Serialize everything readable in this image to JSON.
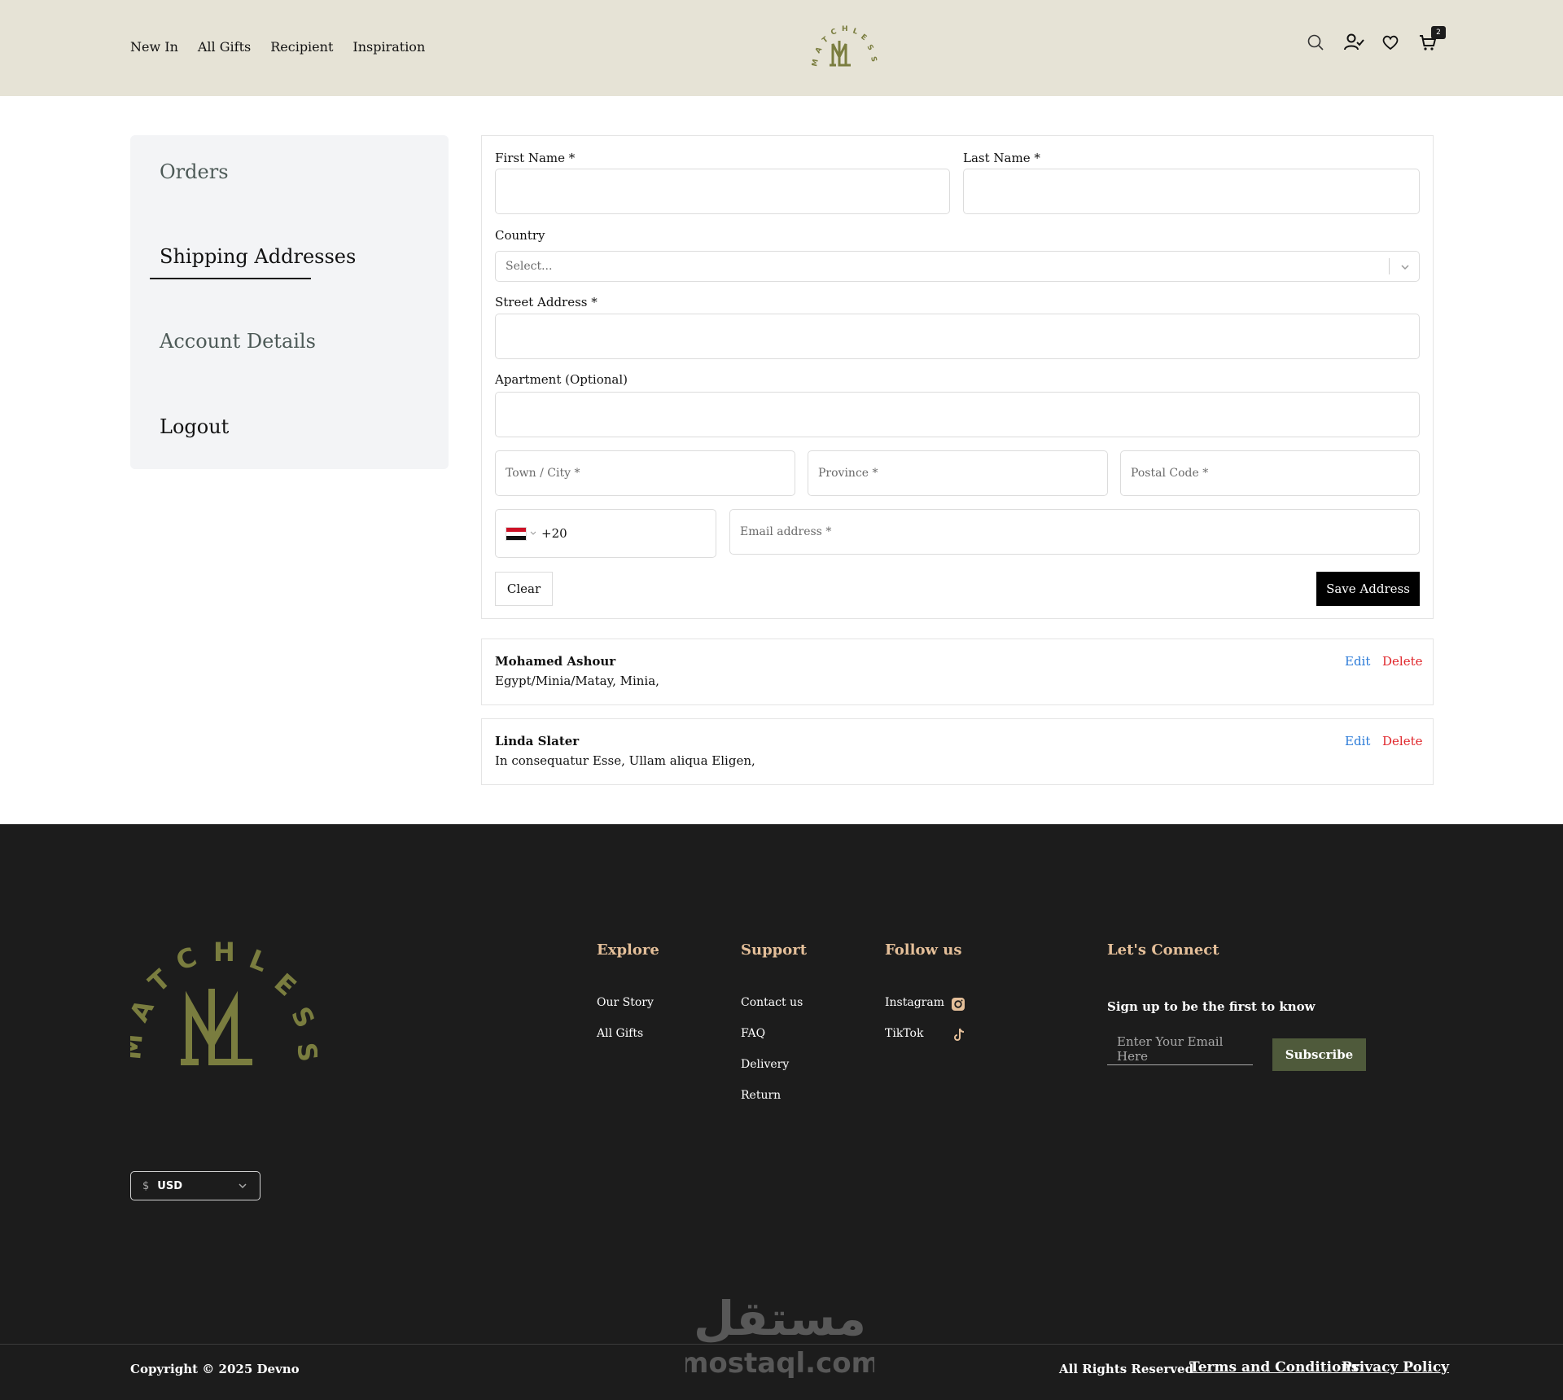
{
  "header": {
    "nav": [
      "New In",
      "All Gifts",
      "Recipient",
      "Inspiration"
    ],
    "cart_count": "2",
    "brand_color": "#7a7d3f"
  },
  "sidebar": {
    "items": [
      "Orders",
      "Shipping Addresses",
      "Account Details",
      "Logout"
    ],
    "active": "Shipping Addresses"
  },
  "form": {
    "first_name_label": "First Name *",
    "last_name_label": "Last Name *",
    "country_label": "Country",
    "country_placeholder": "Select...",
    "street_label": "Street Address *",
    "apartment_label": "Apartment (Optional)",
    "city_placeholder": "Town / City *",
    "province_placeholder": "Province *",
    "postal_placeholder": "Postal Code *",
    "phone_code": "+20",
    "email_placeholder": "Email address *",
    "clear_label": "Clear",
    "save_label": "Save Address"
  },
  "addresses": [
    {
      "name": "Mohamed Ashour",
      "line": "Egypt/Minia/Matay, Minia,",
      "edit": "Edit",
      "delete": "Delete"
    },
    {
      "name": "Linda Slater",
      "line": "In consequatur Esse, Ullam aliqua Eligen,",
      "edit": "Edit",
      "delete": "Delete"
    }
  ],
  "footer": {
    "explore_title": "Explore",
    "explore_links": [
      "Our Story",
      "All Gifts"
    ],
    "support_title": "Support",
    "support_links": [
      "Contact us",
      "FAQ",
      "Delivery",
      "Return"
    ],
    "follow_title": "Follow us",
    "follow_links": [
      "Instagram",
      "TikTok"
    ],
    "connect_title": "Let's Connect",
    "signup_text": "Sign up to be the first to know",
    "email_placeholder": "Enter Your Email Here",
    "subscribe_label": "Subscribe",
    "currency": "USD",
    "copyright": "Copyright © 2025 Devno",
    "rights": "All Rights Reserved",
    "terms": "Terms and Conditions",
    "privacy": "Privacy Policy",
    "accent_color": "#e4bf99"
  },
  "watermark": {
    "arabic": "مستقل",
    "latin": "mostaql.com"
  }
}
